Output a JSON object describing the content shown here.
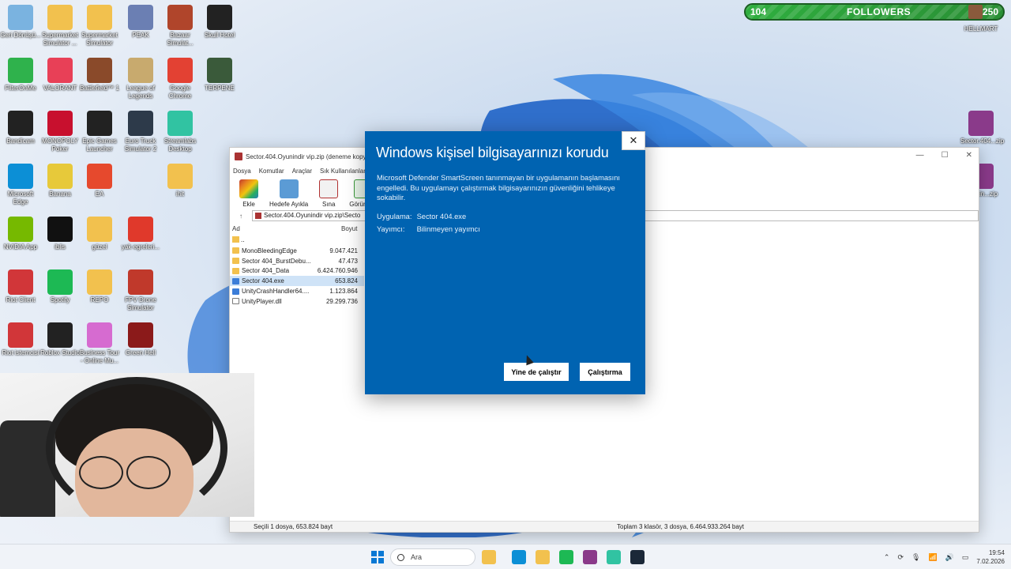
{
  "followers": {
    "current": "104",
    "label": "FOLLOWERS",
    "goal": "250",
    "user": "HELLMART"
  },
  "desktop_icons": [
    {
      "label": "Geri Dönüşü...",
      "color": "#7ab3e0"
    },
    {
      "label": "Supermarket Simulator ...",
      "color": "#f2c14e"
    },
    {
      "label": "Supermarket Simulator",
      "color": "#f2c14e"
    },
    {
      "label": "PEAK",
      "color": "#6b7fb3"
    },
    {
      "label": "Bazaar Simulat...",
      "color": "#b0452b"
    },
    {
      "label": "Skull Hotel",
      "color": "#222"
    },
    {
      "label": "FilterOnMe",
      "color": "#2fb24c"
    },
    {
      "label": "VALORANT",
      "color": "#e84057"
    },
    {
      "label": "Battlefield™ 1",
      "color": "#8a4a2a"
    },
    {
      "label": "League of Legends",
      "color": "#c8aa6e"
    },
    {
      "label": "Google Chrome",
      "color": "#e34133"
    },
    {
      "label": "TERPENE",
      "color": "#3a5a3a"
    },
    {
      "label": "Bandicam",
      "color": "#222"
    },
    {
      "label": "MONOPOLY Poker",
      "color": "#c8102e"
    },
    {
      "label": "Epic Games Launcher",
      "color": "#222"
    },
    {
      "label": "Euro Truck Simulator 2",
      "color": "#2d3a4a"
    },
    {
      "label": "Streamlabs Desktop",
      "color": "#31c3a2"
    },
    {
      "label": "Microsoft Edge",
      "color": "#0c8fd6"
    },
    {
      "label": "Banana",
      "color": "#e7c93a"
    },
    {
      "label": "EA",
      "color": "#e6492d"
    },
    {
      "label": "ihit",
      "color": "#f2c14e"
    },
    {
      "label": "NVIDIA App",
      "color": "#76b900"
    },
    {
      "label": "iblis",
      "color": "#111"
    },
    {
      "label": "güzel",
      "color": "#f2c14e"
    },
    {
      "label": "yak egreleri...",
      "color": "#e0392b"
    },
    {
      "label": "Riot Client",
      "color": "#d13639"
    },
    {
      "label": "Spotify",
      "color": "#1db954"
    },
    {
      "label": "REPO",
      "color": "#f2c14e"
    },
    {
      "label": "FPV Drone Simulator",
      "color": "#c0392b"
    },
    {
      "label": "Riot istemcisi",
      "color": "#d13639"
    },
    {
      "label": "Roblox Studio",
      "color": "#222"
    },
    {
      "label": "Business Tour - Online Mu...",
      "color": "#d66bd0"
    },
    {
      "label": "Green Hell",
      "color": "#8b1a1a"
    },
    {
      "label": "Sector.404...zip",
      "color": "#8a3a8a"
    },
    {
      "label": "Oyunin...zip",
      "color": "#8a3a8a"
    }
  ],
  "winrar": {
    "title": "Sector.404.Oyunindir vip.zip (deneme kopya",
    "menu": [
      "Dosya",
      "Komutlar",
      "Araçlar",
      "Sık Kullanılanlar"
    ],
    "tools": [
      {
        "label": "Ekle",
        "color": "#c0392b"
      },
      {
        "label": "Hedefe Ayıkla",
        "color": "#3b7dd8"
      },
      {
        "label": "Sına",
        "color": "#b03030"
      },
      {
        "label": "Görüntüle",
        "color": "#3a9a3a"
      }
    ],
    "path": "Sector.404.Oyunindir vip.zip\\Secto",
    "columns": {
      "name": "Ad",
      "size": "Boyut"
    },
    "up_folder": "..",
    "files": [
      {
        "name": "MonoBleedingEdge",
        "size": "9.047.421",
        "type": "folder"
      },
      {
        "name": "Sector 404_BurstDebu...",
        "size": "47.473",
        "type": "folder"
      },
      {
        "name": "Sector 404_Data",
        "size": "6.424.760.946",
        "type": "folder"
      },
      {
        "name": "Sector 404.exe",
        "size": "653.824",
        "type": "exe",
        "selected": true
      },
      {
        "name": "UnityCrashHandler64....",
        "size": "1.123.864",
        "type": "exe"
      },
      {
        "name": "UnityPlayer.dll",
        "size": "29.299.736",
        "type": "file"
      }
    ],
    "status_left": "Seçili 1 dosya, 653.824 bayt",
    "status_right": "Toplam 3 klasör, 3 dosya, 6.464.933.264 bayt"
  },
  "dialog": {
    "title": "Windows kişisel bilgisayarınızı korudu",
    "message": "Microsoft Defender SmartScreen tanınmayan bir uygulamanın başlamasını engelledi. Bu uygulamayı çalıştırmak bilgisayarınızın güvenliğini tehlikeye sokabilir.",
    "app_label": "Uygulama:",
    "app_value": "Sector 404.exe",
    "publisher_label": "Yayımcı:",
    "publisher_value": "Bilinmeyen yayımcı",
    "run_anyway": "Yine de çalıştır",
    "dont_run": "Çalıştırma",
    "close_glyph": "✕",
    "bg_color": "#0063b1"
  },
  "taskbar": {
    "search_placeholder": "Ara",
    "time": "19:54",
    "date": "7.02.2026",
    "apps": [
      {
        "name": "file-explorer",
        "color": "#f2c14e"
      },
      {
        "name": "edge",
        "color": "#0c8fd6"
      },
      {
        "name": "folder",
        "color": "#f2c14e"
      },
      {
        "name": "spotify",
        "color": "#1db954"
      },
      {
        "name": "winrar",
        "color": "#8a3a8a"
      },
      {
        "name": "streamlabs",
        "color": "#31c3a2"
      },
      {
        "name": "steam",
        "color": "#1b2838"
      }
    ]
  }
}
